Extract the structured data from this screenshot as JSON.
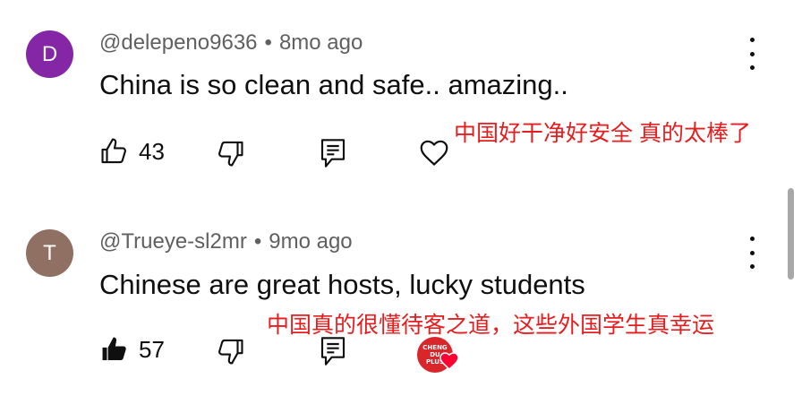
{
  "comments": [
    {
      "avatar_letter": "D",
      "avatar_color": "#8426a6",
      "author": "@delepeno9636",
      "time": "8mo ago",
      "text": "China is so clean and safe.. amazing..",
      "translation": "中国好干净好安全 真的太棒了",
      "likes": "43",
      "liked": false
    },
    {
      "avatar_letter": "T",
      "avatar_color": "#917064",
      "author": "@Trueye-sl2mr",
      "time": "9mo ago",
      "text": "Chinese are great hosts, lucky students",
      "translation": "中国真的很懂待客之道，这些外国学生真幸运",
      "likes": "57",
      "liked": true,
      "creator_badge": "CHENG DU PLUS"
    }
  ],
  "colors": {
    "overlay_text": "#e41e1e",
    "meta_text": "#606060"
  }
}
